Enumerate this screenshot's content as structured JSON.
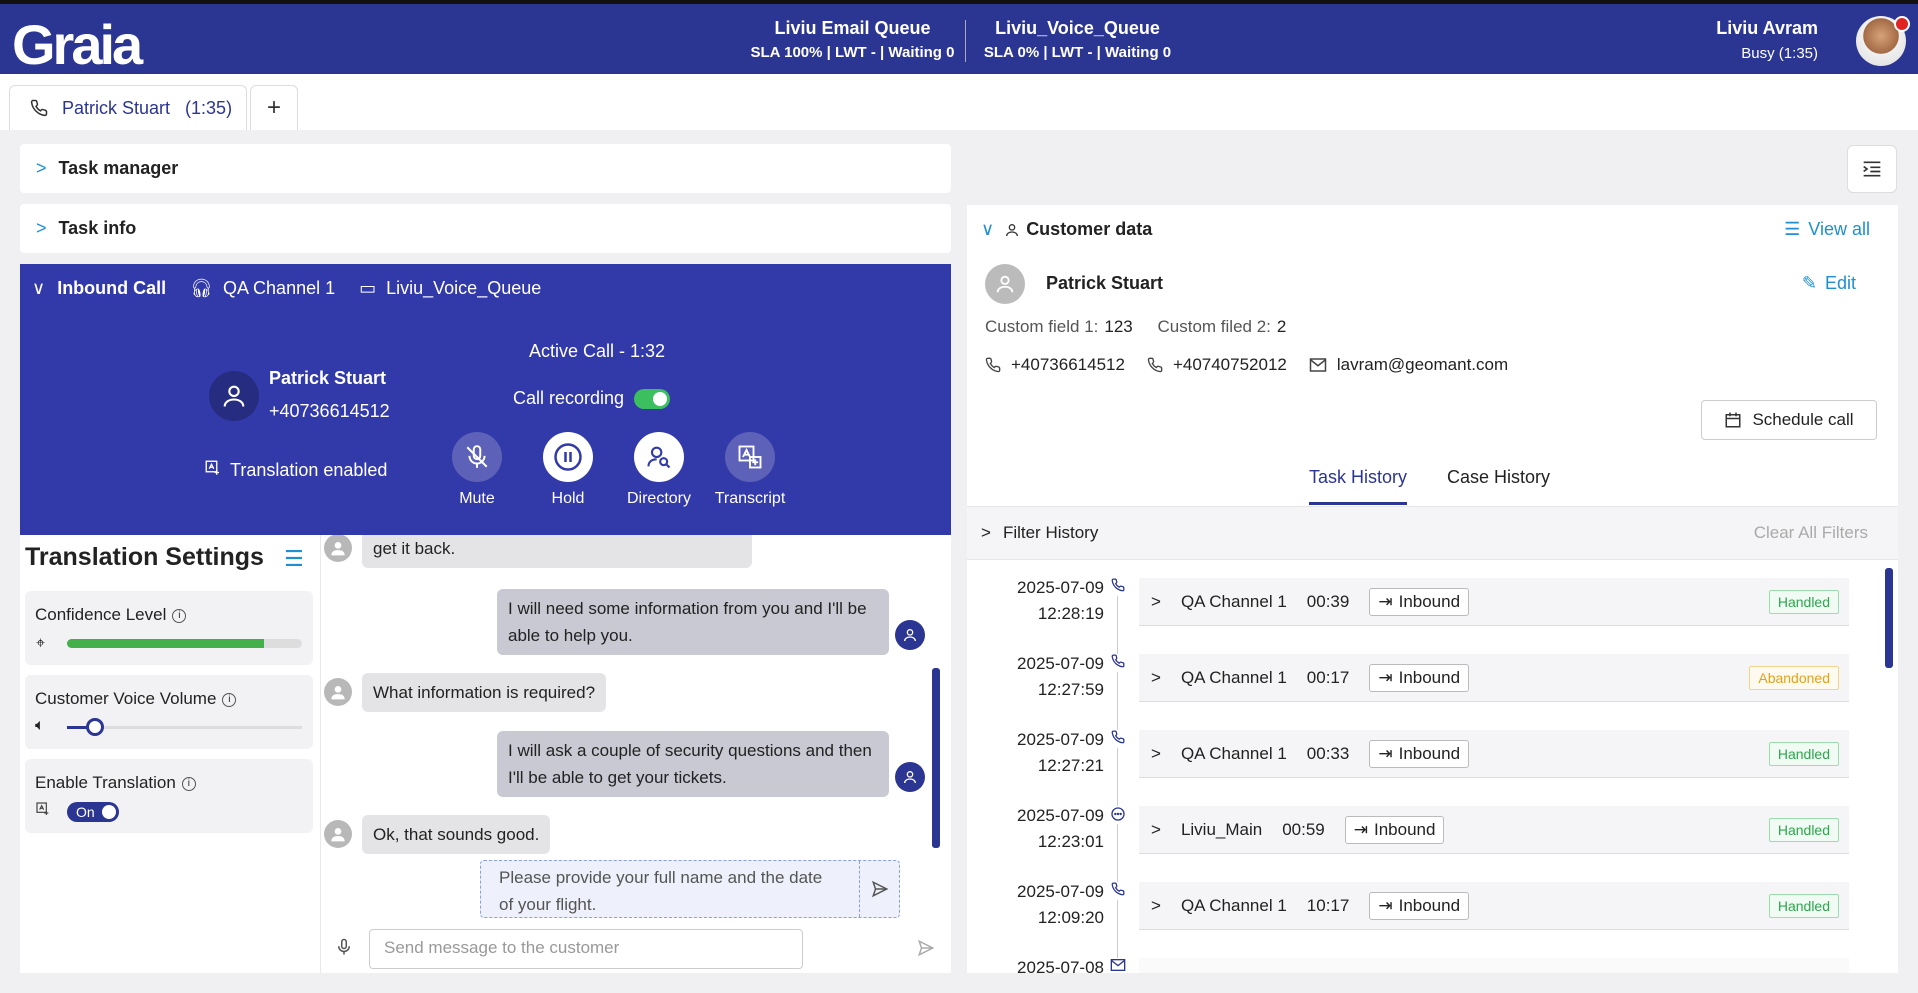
{
  "header": {
    "logo": "Graia",
    "queues": [
      {
        "name": "Liviu Email Queue",
        "stats": "SLA 100% | LWT - | Waiting 0"
      },
      {
        "name": "Liviu_Voice_Queue",
        "stats": "SLA 0% | LWT - | Waiting 0"
      }
    ],
    "user": {
      "name": "Liviu Avram",
      "status": "Busy (1:35)"
    }
  },
  "tabs": [
    {
      "label": "Patrick Stuart   (1:35)"
    },
    {
      "label": "+"
    }
  ],
  "sections": {
    "task_manager": "Task manager",
    "task_info": "Task info"
  },
  "call": {
    "title": "Inbound Call",
    "channel": "QA Channel 1",
    "queue": "Liviu_Voice_Queue",
    "contact_name": "Patrick Stuart",
    "contact_phone": "+40736614512",
    "translation": "Translation enabled",
    "active": "Active Call - 1:32",
    "recording_label": "Call recording",
    "buttons": [
      "Mute",
      "Hold",
      "Directory",
      "Transcript"
    ]
  },
  "translation_settings": {
    "title": "Translation Settings",
    "confidence_label": "Confidence Level",
    "confidence_value": 0.84,
    "volume_label": "Customer Voice Volume",
    "volume_value": 0.12,
    "enable_label": "Enable Translation",
    "enable_state": "On"
  },
  "chat": {
    "messages": [
      {
        "from": "customer",
        "text": "get it back."
      },
      {
        "from": "agent",
        "text": "I will need some information from you and I'll be able to help you."
      },
      {
        "from": "customer",
        "text": "What information is required?"
      },
      {
        "from": "agent",
        "text": "I will ask a couple of security questions and then I'll be able to get your tickets."
      },
      {
        "from": "customer",
        "text": "Ok, that sounds good."
      }
    ],
    "suggestion": "Please provide your full name and the date of your flight.",
    "input_placeholder": "Send message to the customer"
  },
  "customer": {
    "section_title": "Customer data",
    "view_all": "View all",
    "name": "Patrick Stuart",
    "edit": "Edit",
    "field1_label": "Custom field 1:",
    "field1_value": "123",
    "field2_label": "Custom filed 2:",
    "field2_value": "2",
    "phone1": "+40736614512",
    "phone2": "+40740752012",
    "email": "lavram@geomant.com",
    "schedule": "Schedule call"
  },
  "history": {
    "tabs": [
      "Task History",
      "Case History"
    ],
    "filter": "Filter History",
    "clear": "Clear All Filters",
    "rows": [
      {
        "date": "2025-07-09",
        "time": "12:28:19",
        "channel": "QA Channel 1",
        "duration": "00:39",
        "direction": "Inbound",
        "status": "Handled",
        "type": "phone-icon"
      },
      {
        "date": "2025-07-09",
        "time": "12:27:59",
        "channel": "QA Channel 1",
        "duration": "00:17",
        "direction": "Inbound",
        "status": "Abandoned",
        "type": "phone-icon"
      },
      {
        "date": "2025-07-09",
        "time": "12:27:21",
        "channel": "QA Channel 1",
        "duration": "00:33",
        "direction": "Inbound",
        "status": "Handled",
        "type": "phone-icon"
      },
      {
        "date": "2025-07-09",
        "time": "12:23:01",
        "channel": "Liviu_Main",
        "duration": "00:59",
        "direction": "Inbound",
        "status": "Handled",
        "type": "chat-icon"
      },
      {
        "date": "2025-07-09",
        "time": "12:09:20",
        "channel": "QA Channel 1",
        "duration": "10:17",
        "direction": "Inbound",
        "status": "Handled",
        "type": "phone-icon"
      },
      {
        "date": "2025-07-08",
        "time": "",
        "channel": "",
        "duration": "",
        "direction": "",
        "status": "",
        "type": "email-icon"
      }
    ]
  }
}
